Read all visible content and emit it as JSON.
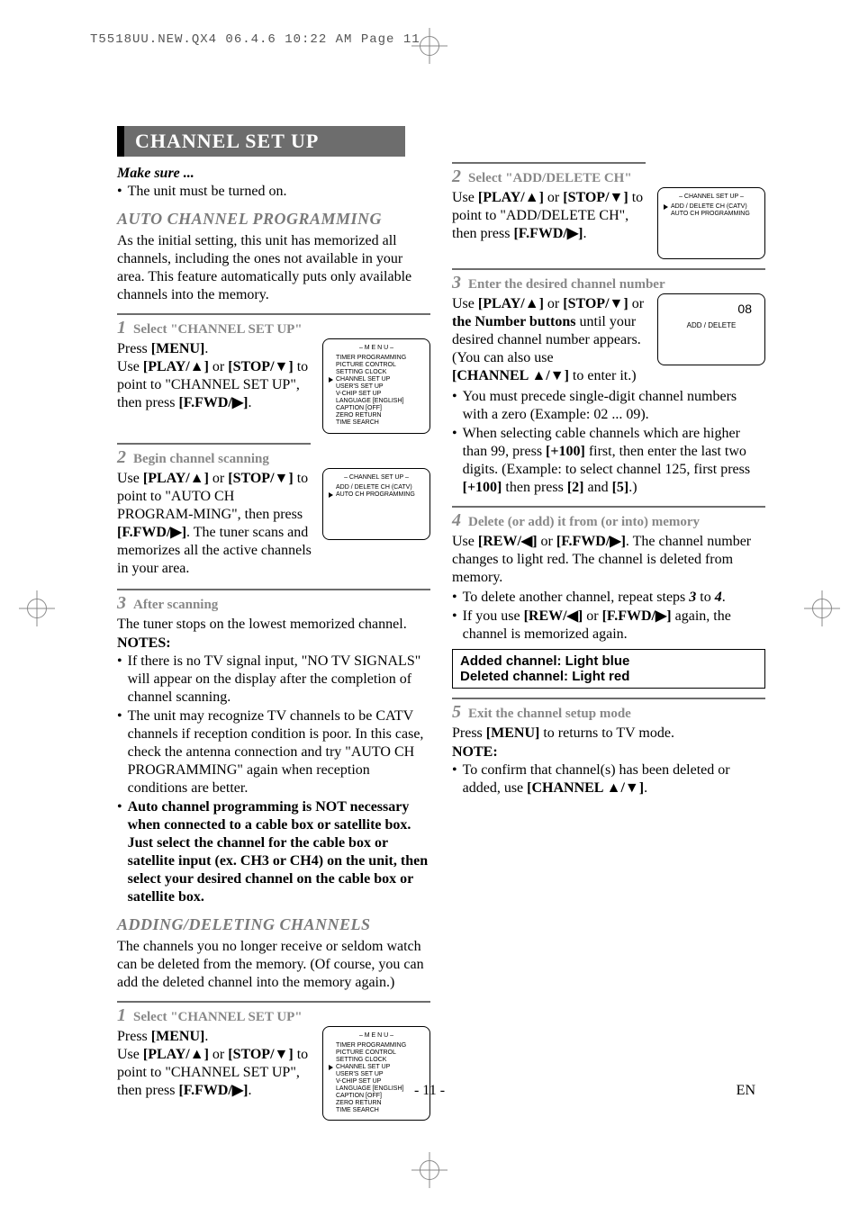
{
  "prepress": "T5518UU.NEW.QX4  06.4.6  10:22 AM  Page 11",
  "pageNumber": "- 11 -",
  "langCode": "EN",
  "header": "CHANNEL SET UP",
  "left": {
    "makeSure": "Make sure ...",
    "makeSureBullet": "The unit must be turned on.",
    "autoHeading": "AUTO CHANNEL PROGRAMMING",
    "autoIntro": "As the initial setting, this unit has memorized all channels, including the ones not available in your area. This feature automatically puts only available channels into the memory.",
    "step1": {
      "num": "1",
      "title": "Select \"CHANNEL SET UP\"",
      "body": "Press [MENU]. Use [PLAY/▲] or [STOP/▼] to point to \"CHANNEL SET UP\", then press [F.FWD/▶]."
    },
    "step2": {
      "num": "2",
      "title": "Begin channel scanning",
      "body": "Use [PLAY/▲] or [STOP/▼] to point to \"AUTO CH PROGRAMMING\", then press [F.FWD/▶]. The tuner scans and memorizes all the active channels in your area."
    },
    "step3": {
      "num": "3",
      "title": "After scanning",
      "body": "The tuner stops on the lowest memorized channel."
    },
    "notesLabel": "NOTES:",
    "note1": "If there is no TV signal input, \"NO TV SIGNALS\" will appear on the display after the completion of channel scanning.",
    "note2": "The unit may recognize TV channels to be CATV channels if reception condition is poor. In this case, check the antenna connection and try \"AUTO CH PROGRAMMING\" again when reception conditions are better.",
    "note3": "Auto channel programming is NOT necessary when connected to a cable box or satellite box. Just select the channel for the cable box or satellite input (ex. CH3 or CH4) on the unit, then select your desired channel on the cable box or satellite box.",
    "addDelHeading": "ADDING/DELETING CHANNELS",
    "addDelIntro": "The channels you no longer receive or seldom watch can be deleted from the memory. (Of course, you can add the deleted channel into the memory again.)",
    "adStep1": {
      "num": "1",
      "title": "Select \"CHANNEL SET UP\"",
      "body": "Press [MENU]. Use [PLAY/▲] or [STOP/▼] to point to \"CHANNEL SET UP\", then press [F.FWD/▶]."
    },
    "menuOsd": {
      "title": "– M E N U –",
      "items": [
        "TIMER PROGRAMMING",
        "PICTURE CONTROL",
        "SETTING CLOCK",
        "CHANNEL SET UP",
        "USER'S SET UP",
        "V-CHIP SET UP",
        "LANGUAGE  [ENGLISH]",
        "CAPTION  [OFF]",
        "ZERO RETURN",
        "TIME SEARCH"
      ],
      "cursorIndex": 3
    },
    "chsetOsd": {
      "title": "– CHANNEL SET UP –",
      "items": [
        "ADD / DELETE CH (CATV)",
        "AUTO CH PROGRAMMING"
      ],
      "cursorIndex": 1
    }
  },
  "right": {
    "step2": {
      "num": "2",
      "title": "Select \"ADD/DELETE CH\"",
      "body": "Use [PLAY/▲] or [STOP/▼] to point to \"ADD/DELETE CH\", then press [F.FWD/▶]."
    },
    "chsetOsd": {
      "title": "– CHANNEL SET UP –",
      "items": [
        "ADD / DELETE CH (CATV)",
        "AUTO CH PROGRAMMING"
      ],
      "cursorIndex": 0
    },
    "step3": {
      "num": "3",
      "title": "Enter the desired channel number",
      "body1": "Use [PLAY/▲] or [STOP/▼] or the Number buttons until your desired channel number appears. (You can also use [CHANNEL ▲/▼] to enter it.)",
      "bullet1": "You must precede single-digit channel numbers with a zero (Example: 02 ...  09).",
      "bullet2": "When selecting cable channels which are higher than 99, press [+100] first, then enter the last two digits. (Example: to select channel 125, first press [+100] then press [2] and [5].)"
    },
    "numOsd": {
      "num": "08",
      "label": "ADD / DELETE"
    },
    "step4": {
      "num": "4",
      "title": "Delete (or add) it from (or into) memory",
      "body": "Use [REW/◀] or [F.FWD/▶]. The channel number changes to light red. The channel is deleted from memory.",
      "bullet1": "To delete another channel, repeat steps 3 to 4.",
      "bullet2": "If you use [REW/◀] or [F.FWD/▶] again, the channel is memorized again."
    },
    "callout1": "Added channel: Light blue",
    "callout2": "Deleted channel: Light red",
    "step5": {
      "num": "5",
      "title": "Exit the channel setup mode",
      "body": "Press [MENU] to returns to TV mode."
    },
    "noteLabel": "NOTE:",
    "note1": "To confirm that channel(s) has been deleted or added, use [CHANNEL ▲/▼]."
  }
}
